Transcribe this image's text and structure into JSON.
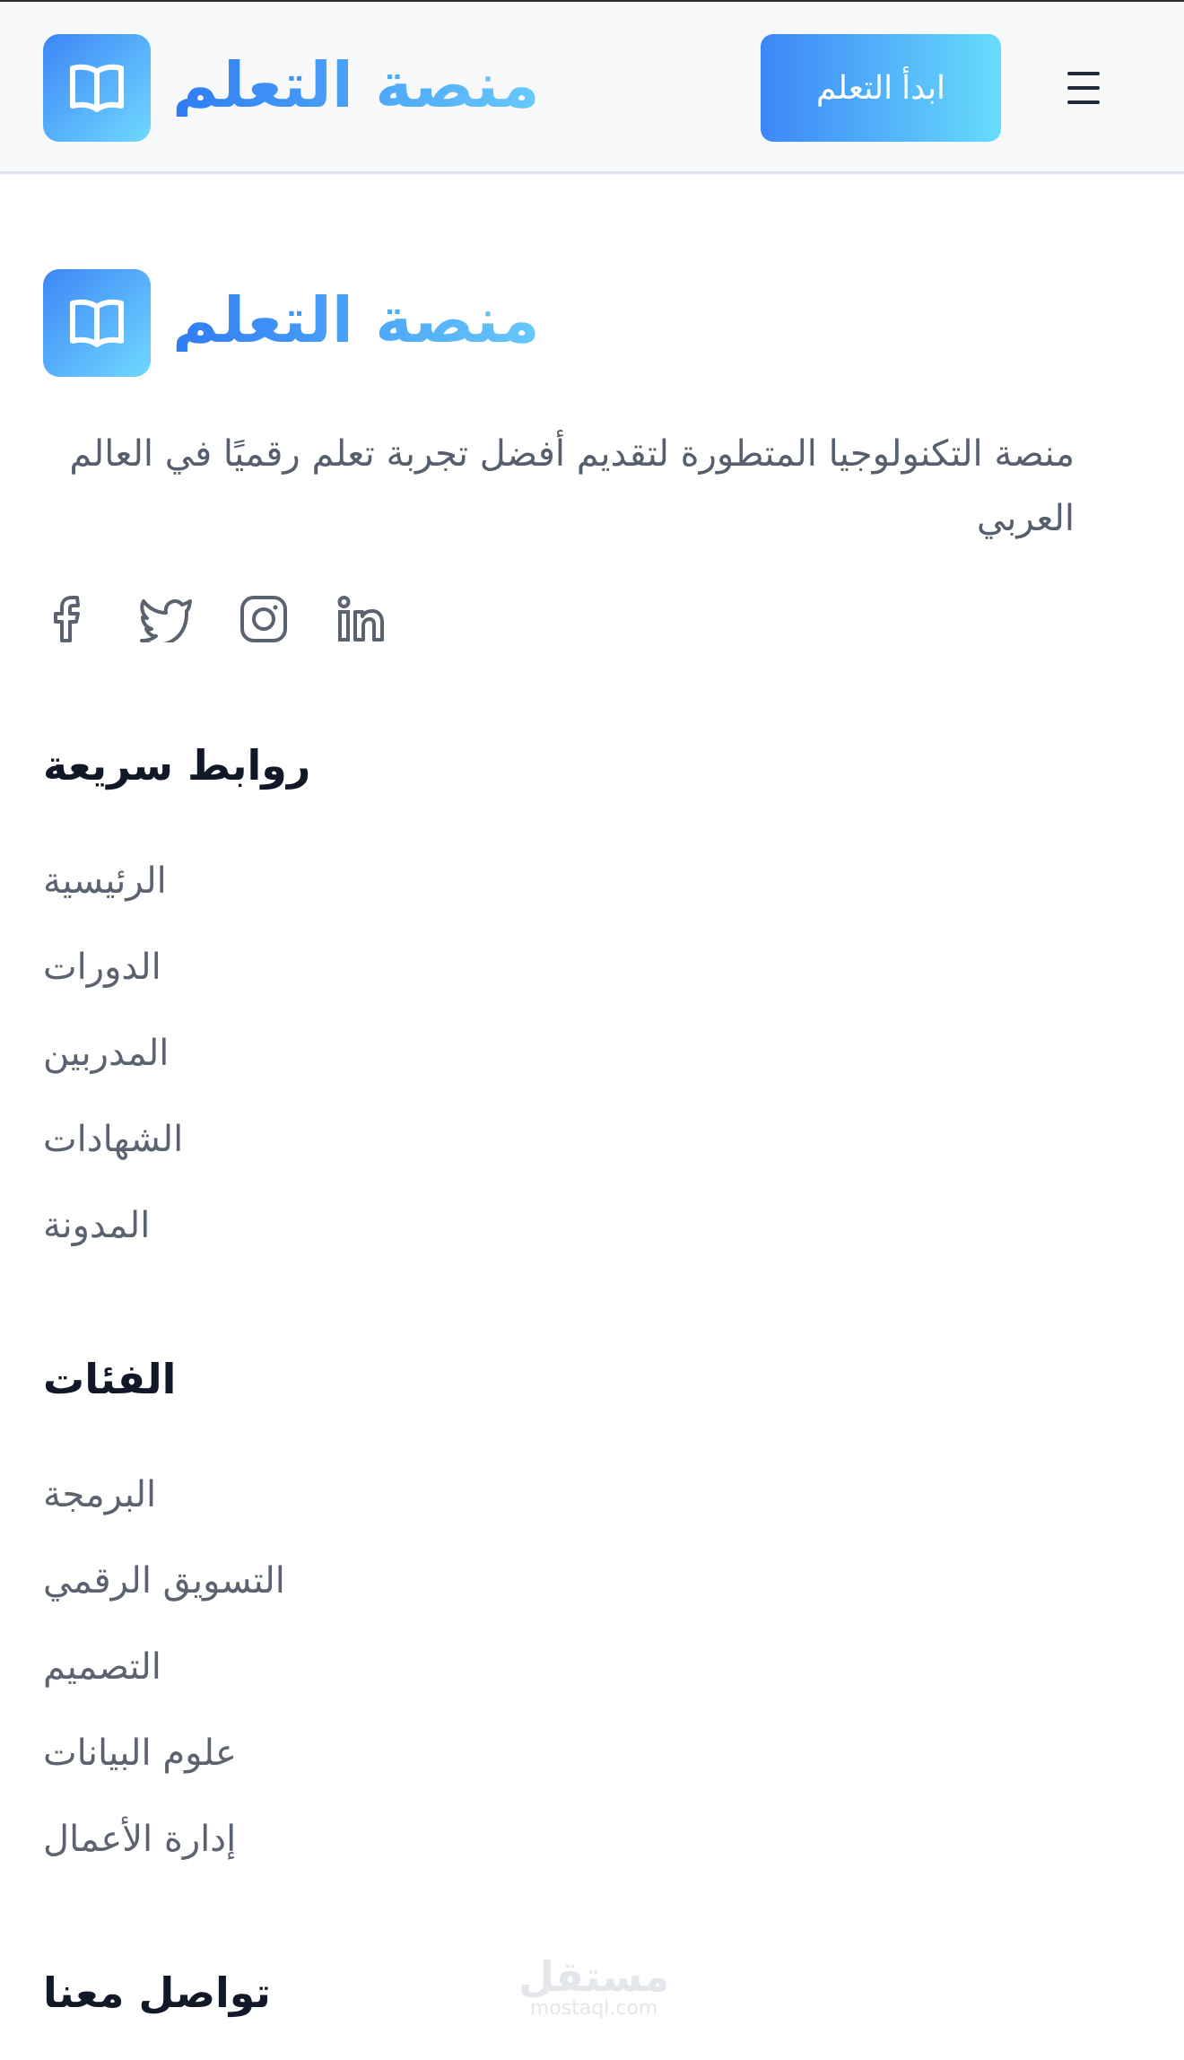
{
  "header": {
    "brand": "منصة التعلم",
    "logo_icon": "book-icon",
    "cta_label": "ابدأ التعلم",
    "menu_icon": "hamburger-menu-icon"
  },
  "footer": {
    "brand": "منصة التعلم",
    "description": "منصة التكنولوجيا المتطورة لتقديم أفضل تجربة تعلم رقميًا في العالم العربي",
    "socials": [
      "facebook-icon",
      "twitter-icon",
      "instagram-icon",
      "linkedin-icon"
    ],
    "quick_links": {
      "title": "روابط سريعة",
      "items": [
        "الرئيسية",
        "الدورات",
        "المدربين",
        "الشهادات",
        "المدونة"
      ]
    },
    "categories": {
      "title": "الفئات",
      "items": [
        "البرمجة",
        "التسويق الرقمي",
        "التصميم",
        "علوم البيانات",
        "إدارة الأعمال"
      ]
    },
    "contact": {
      "title": "تواصل معنا"
    }
  },
  "watermark": {
    "arabic": "مستقل",
    "latin": "mostaql.com"
  },
  "colors": {
    "accent_start": "#3c86f6",
    "accent_end": "#67dcfd",
    "text_muted": "#5b6270",
    "heading": "#111827"
  }
}
